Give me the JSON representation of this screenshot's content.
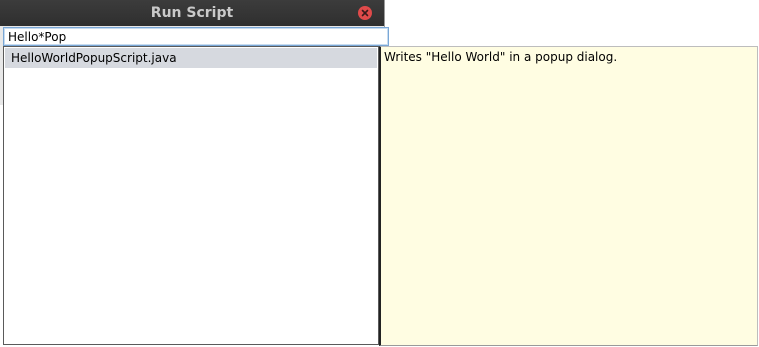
{
  "window": {
    "title": "Run Script"
  },
  "search": {
    "value": "Hello*Pop"
  },
  "results": [
    {
      "label": "HelloWorldPopupScript.java",
      "selected": true
    }
  ],
  "description": {
    "text": "Writes \"Hello World\" in a popup dialog."
  },
  "colors": {
    "titlebar": "#333333",
    "close_button": "#e04a4a",
    "selection": "#d6d9df",
    "description_bg": "#fffde2"
  },
  "icons": {
    "close": "close-icon"
  }
}
